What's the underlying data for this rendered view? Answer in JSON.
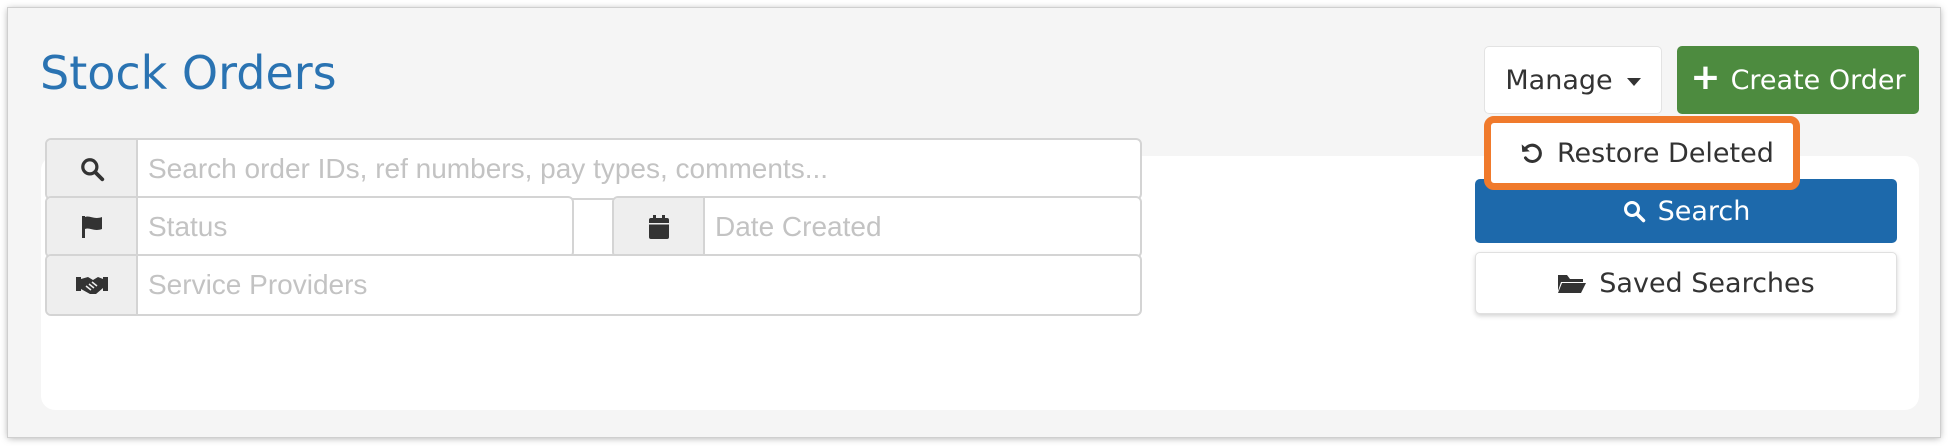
{
  "header": {
    "title": "Stock Orders",
    "manage_label": "Manage",
    "create_label": "Create Order"
  },
  "manage_menu": {
    "items": [
      {
        "label": "Restore Deleted",
        "icon": "undo-icon"
      }
    ]
  },
  "filters": {
    "search": {
      "placeholder": "Search order IDs, ref numbers, pay types, comments...",
      "value": "",
      "icon": "search-icon"
    },
    "status": {
      "placeholder": "Status",
      "value": "",
      "icon": "flag-icon"
    },
    "date_created": {
      "placeholder": "Date Created",
      "value": "",
      "icon": "calendar-icon"
    },
    "service_providers": {
      "placeholder": "Service Providers",
      "value": "",
      "icon": "handshake-icon"
    }
  },
  "actions": {
    "search_label": "Search",
    "saved_searches_label": "Saved Searches"
  },
  "colors": {
    "title_blue": "#2a73b2",
    "create_green": "#4d8b3f",
    "search_blue": "#1d69ab",
    "highlight_orange": "#f07a2c",
    "page_background": "#f5f5f5"
  }
}
